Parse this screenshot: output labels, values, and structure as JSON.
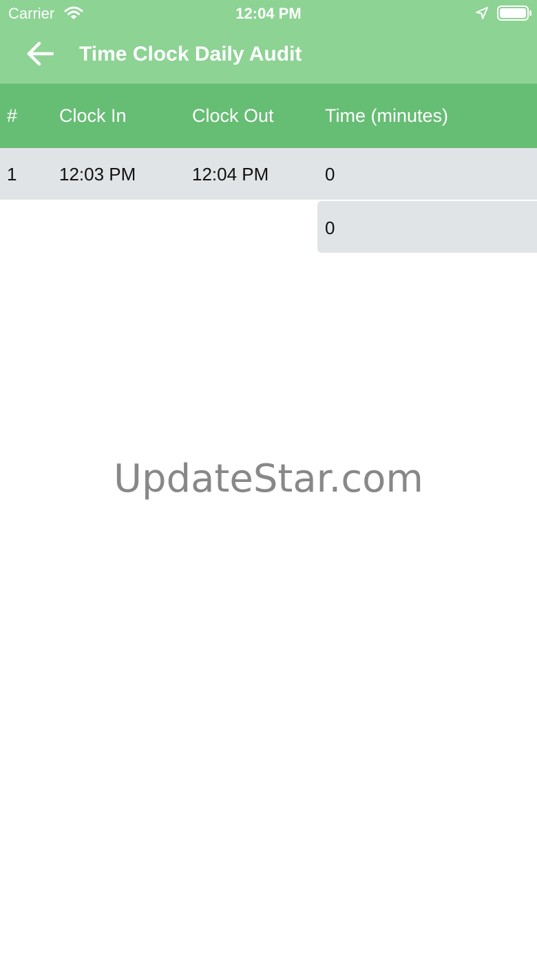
{
  "status_bar": {
    "carrier": "Carrier",
    "time": "12:04 PM",
    "icons": [
      "wifi-icon",
      "location-arrow-icon",
      "battery-icon"
    ]
  },
  "nav": {
    "back_icon": "arrow-left-icon",
    "title": "Time Clock Daily Audit"
  },
  "table": {
    "columns": [
      "#",
      "Clock In",
      "Clock Out",
      "Time (minutes)"
    ],
    "rows": [
      {
        "num": "1",
        "clock_in": "12:03 PM",
        "clock_out": "12:04 PM",
        "minutes": "0"
      }
    ],
    "total_minutes": "0"
  },
  "watermark": "UpdateStar.com",
  "colors": {
    "nav_green": "#8dd394",
    "header_green": "#66bd74",
    "row_gray": "#e1e4e6"
  }
}
